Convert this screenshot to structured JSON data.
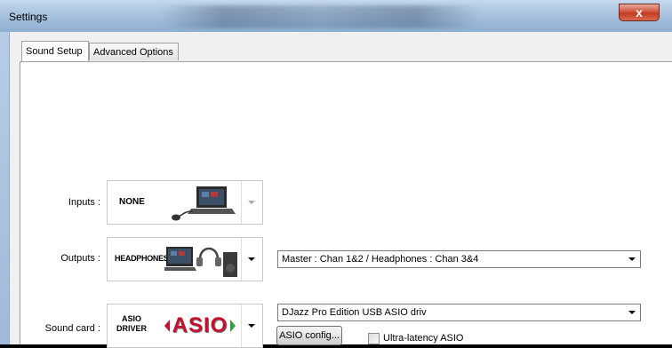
{
  "window": {
    "title": "Settings",
    "close_glyph": "x"
  },
  "tabs": [
    {
      "label": "Sound Setup",
      "active": true
    },
    {
      "label": "Advanced Options",
      "active": false
    }
  ],
  "inputs": {
    "label": "Inputs :",
    "image_text": "NONE",
    "icon": "laptop-with-mouse-icon"
  },
  "outputs": {
    "label": "Outputs :",
    "image_text": "HEADPHONES",
    "icon": "laptop-headphones-speaker-icon",
    "routing_value": "Master : Chan 1&2 / Headphones : Chan 3&4"
  },
  "soundcard": {
    "label": "Sound card :",
    "image_text_line1": "ASIO",
    "image_text_line2": "DRIVER",
    "logo_text": "ASIO",
    "device_value": "DJazz Pro Edition USB ASIO driv",
    "config_button": "ASIO config...",
    "ultra_latency_label": "Ultra-latency ASIO",
    "ultra_latency_checked": false
  },
  "colors": {
    "close_red": "#c43a23",
    "asio_red": "#c8102e",
    "asio_green": "#2e9e3e"
  }
}
